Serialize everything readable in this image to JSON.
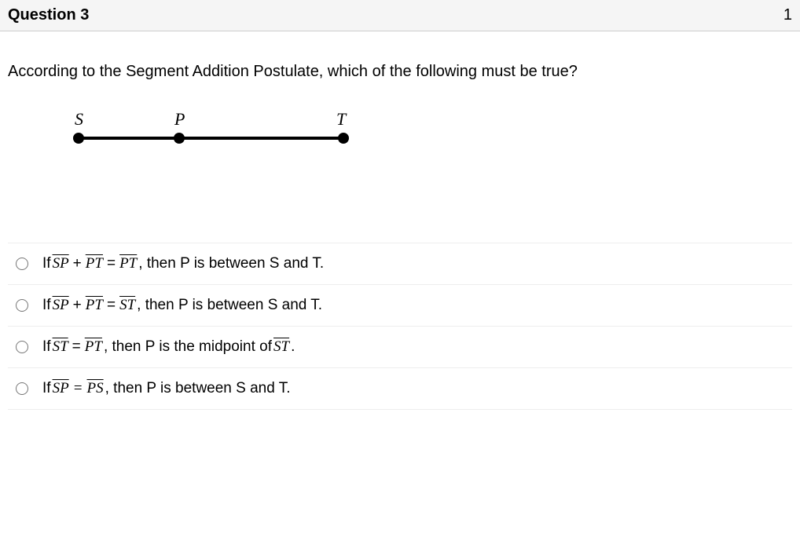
{
  "header": {
    "title": "Question 3",
    "points": "1"
  },
  "body": {
    "question_text": "According to the Segment Addition Postulate, which of the following must be true?",
    "diagram": {
      "labels": {
        "s": "S",
        "p": "P",
        "t": "T"
      }
    }
  },
  "options": [
    {
      "prefix": "If ",
      "seg1": "SP",
      "mid1": " + ",
      "seg2": "PT",
      "mid2": " = ",
      "seg3": "PT",
      "suffix": ", then P is between S and T."
    },
    {
      "prefix": "If ",
      "seg1": "SP",
      "mid1": " + ",
      "seg2": "PT",
      "mid2": " = ",
      "seg3": "ST",
      "suffix": ", then P is between S and T."
    },
    {
      "prefix": "If ",
      "seg1": "ST",
      "mid1": " = ",
      "seg2": "PT",
      "mid2": "",
      "seg3": "",
      "suffix": ", then P is the midpoint of ",
      "seg4": "ST",
      "end": "."
    },
    {
      "prefix": "If ",
      "seg1": "SP",
      "mid1": " = ",
      "seg2": "PS",
      "mid2": "",
      "seg3": "",
      "suffix": ", then P is between S and T."
    }
  ]
}
